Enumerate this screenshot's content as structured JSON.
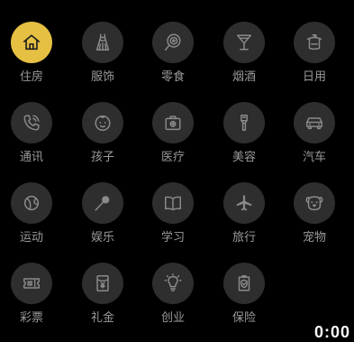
{
  "categories": [
    {
      "label": "住房",
      "icon": "house-icon",
      "selected": true
    },
    {
      "label": "服饰",
      "icon": "dress-icon",
      "selected": false
    },
    {
      "label": "零食",
      "icon": "lollipop-icon",
      "selected": false
    },
    {
      "label": "烟酒",
      "icon": "cocktail-icon",
      "selected": false
    },
    {
      "label": "日用",
      "icon": "household-item-icon",
      "selected": false
    },
    {
      "label": "通讯",
      "icon": "phone-icon",
      "selected": false
    },
    {
      "label": "孩子",
      "icon": "baby-face-icon",
      "selected": false
    },
    {
      "label": "医疗",
      "icon": "medical-kit-icon",
      "selected": false
    },
    {
      "label": "美容",
      "icon": "cosmetics-icon",
      "selected": false
    },
    {
      "label": "汽车",
      "icon": "car-icon",
      "selected": false
    },
    {
      "label": "运动",
      "icon": "ball-icon",
      "selected": false
    },
    {
      "label": "娱乐",
      "icon": "microphone-icon",
      "selected": false
    },
    {
      "label": "学习",
      "icon": "book-icon",
      "selected": false
    },
    {
      "label": "旅行",
      "icon": "airplane-icon",
      "selected": false
    },
    {
      "label": "宠物",
      "icon": "dog-face-icon",
      "selected": false
    },
    {
      "label": "彩票",
      "icon": "lottery-ticket-icon",
      "selected": false
    },
    {
      "label": "礼金",
      "icon": "red-envelope-icon",
      "selected": false
    },
    {
      "label": "创业",
      "icon": "lightbulb-icon",
      "selected": false
    },
    {
      "label": "保险",
      "icon": "insurance-shield-icon",
      "selected": false
    }
  ],
  "colors": {
    "background": "#000000",
    "circle": "#2e2e2e",
    "selected": "#e6c043",
    "label": "#9a9a9a",
    "icon": "#8a8a8a"
  },
  "corner_text": "0:00"
}
